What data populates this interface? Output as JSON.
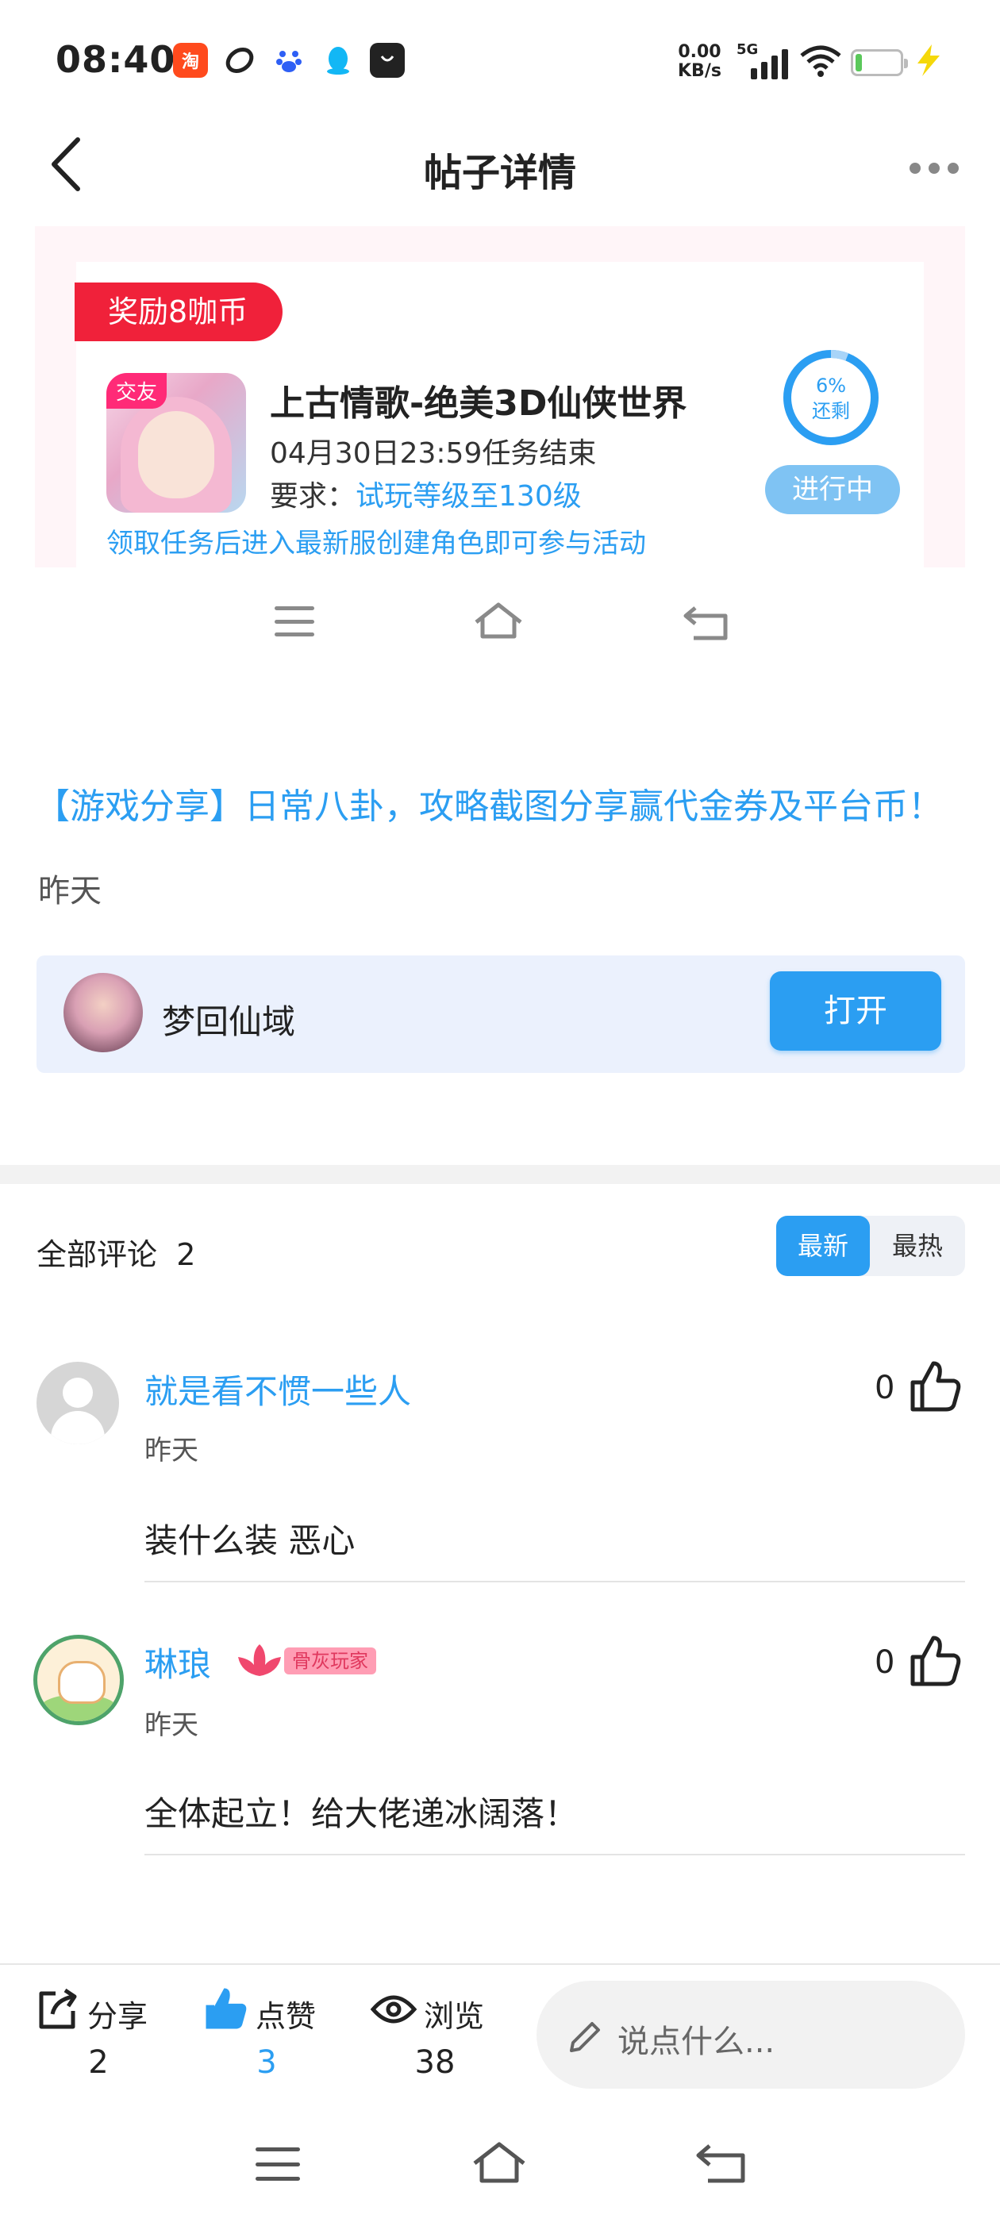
{
  "status_bar": {
    "time": "08:40",
    "net_speed_value": "0.00",
    "net_speed_unit": "KB/s",
    "network": "5G",
    "app_icons": [
      "taobao-icon",
      "app-icon",
      "baidu-icon",
      "qq-icon",
      "bag-icon"
    ],
    "battery_level": 0.15
  },
  "header": {
    "title": "帖子详情"
  },
  "task_card": {
    "reward": "奖励8咖币",
    "icon_tag": "交友",
    "game_title": "上古情歌-绝美3D仙侠世界",
    "deadline": "04月30日23:59任务结束",
    "requirement_label": "要求：",
    "requirement_value": "试玩等级至130级",
    "note": "领取任务后进入最新服创建角色即可参与活动",
    "progress_percent": "6%",
    "progress_label": "还剩",
    "progress_value": 0.06,
    "status": "进行中"
  },
  "post": {
    "title": "【游戏分享】日常八卦，攻略截图分享赢代金券及平台币！",
    "time": "昨天"
  },
  "app_row": {
    "name": "梦回仙域",
    "open_label": "打开"
  },
  "comments_header": {
    "label": "全部评论",
    "count": "2",
    "sort_new": "最新",
    "sort_hot": "最热"
  },
  "comments": [
    {
      "name": "就是看不惯一些人",
      "time": "昨天",
      "text": "装什么装  恶心",
      "likes": "0"
    },
    {
      "name": "琳琅",
      "badge": "骨灰玩家",
      "time": "昨天",
      "text": "全体起立！给大佬递冰阔落！",
      "likes": "0"
    }
  ],
  "bottom_bar": {
    "share_label": "分享",
    "share_count": "2",
    "like_label": "点赞",
    "like_count": "3",
    "view_label": "浏览",
    "view_count": "38",
    "comment_placeholder": "说点什么..."
  },
  "colors": {
    "accent": "#2b9ef2",
    "reward": "#f0213a",
    "like_active": "#2b9ef2"
  }
}
